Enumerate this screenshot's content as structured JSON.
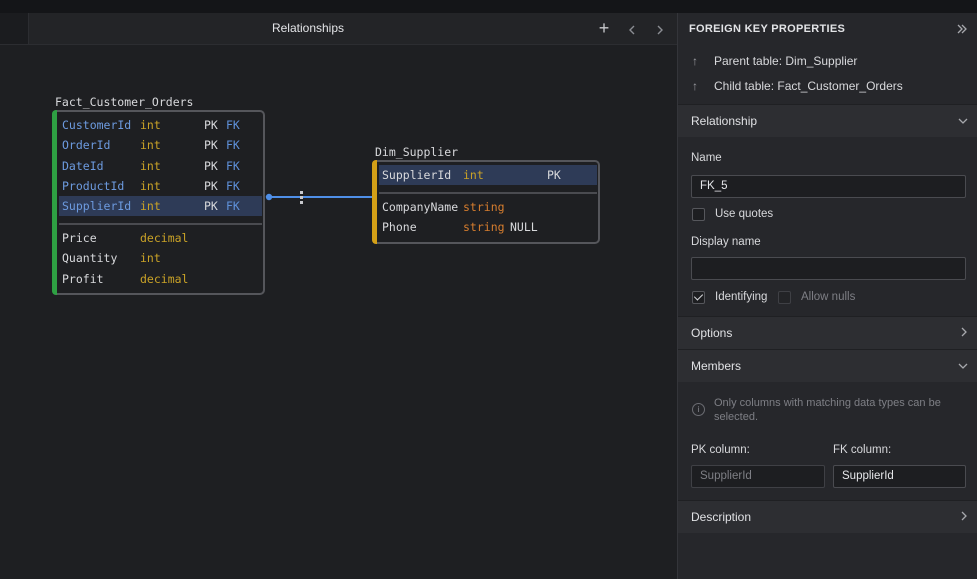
{
  "tab": {
    "title": "Relationships",
    "add_icon": "plus-icon",
    "prev_icon": "chevron-left-icon",
    "next_icon": "chevron-right-icon"
  },
  "diagram": {
    "fact_table": {
      "name": "Fact_Customer_Orders",
      "accent": "#2ea043",
      "key_columns": [
        {
          "name": "CustomerId",
          "type": "int",
          "pk": "PK",
          "fk": "FK"
        },
        {
          "name": "OrderId",
          "type": "int",
          "pk": "PK",
          "fk": "FK"
        },
        {
          "name": "DateId",
          "type": "int",
          "pk": "PK",
          "fk": "FK"
        },
        {
          "name": "ProductId",
          "type": "int",
          "pk": "PK",
          "fk": "FK"
        },
        {
          "name": "SupplierId",
          "type": "int",
          "pk": "PK",
          "fk": "FK",
          "selected": true
        }
      ],
      "columns": [
        {
          "name": "Price",
          "type": "decimal"
        },
        {
          "name": "Quantity",
          "type": "int"
        },
        {
          "name": "Profit",
          "type": "decimal"
        }
      ]
    },
    "dim_table": {
      "name": "Dim_Supplier",
      "accent": "#d4a017",
      "key_columns": [
        {
          "name": "SupplierId",
          "type": "int",
          "pk": "PK",
          "selected": true
        }
      ],
      "columns": [
        {
          "name": "CompanyName",
          "type": "string",
          "null": ""
        },
        {
          "name": "Phone",
          "type": "string",
          "null": "NULL"
        }
      ]
    },
    "relationship_color": "#4f8fe8"
  },
  "panel": {
    "title": "FOREIGN KEY PROPERTIES",
    "collapse_icon": "double-chevron-right-icon",
    "parent_table": "Parent table: Dim_Supplier",
    "child_table": "Child table: Fact_Customer_Orders",
    "sections": {
      "relationship": "Relationship",
      "options": "Options",
      "members": "Members",
      "description": "Description"
    },
    "name_label": "Name",
    "name_value": "FK_5",
    "use_quotes": {
      "label": "Use quotes",
      "checked": false
    },
    "display_name_label": "Display name",
    "display_name_value": "",
    "identifying": {
      "label": "Identifying",
      "checked": true
    },
    "allow_nulls": {
      "label": "Allow nulls",
      "checked": false,
      "disabled": true
    },
    "members_note": "Only columns with matching data types can be selected.",
    "pk_column_label": "PK column:",
    "fk_column_label": "FK column:",
    "pk_column_value": "SupplierId",
    "fk_column_value": "SupplierId"
  }
}
